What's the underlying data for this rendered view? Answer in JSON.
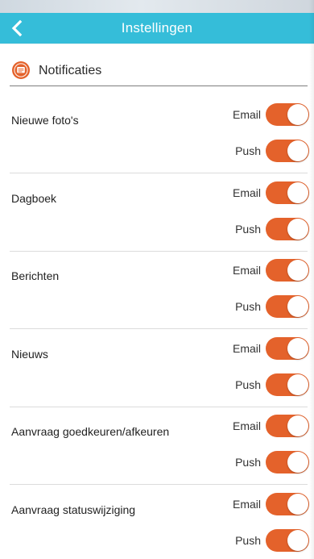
{
  "header": {
    "title": "Instellingen",
    "back_icon": "chevron-left-icon"
  },
  "section": {
    "title": "Notificaties",
    "icon": "message-icon"
  },
  "colors": {
    "header_bg": "#35bdd9",
    "accent": "#e4622b"
  },
  "groups": [
    {
      "label": "Nieuwe foto's",
      "options": [
        {
          "label": "Email",
          "on": true
        },
        {
          "label": "Push",
          "on": true
        }
      ]
    },
    {
      "label": "Dagboek",
      "options": [
        {
          "label": "Email",
          "on": true
        },
        {
          "label": "Push",
          "on": true
        }
      ]
    },
    {
      "label": "Berichten",
      "options": [
        {
          "label": "Email",
          "on": true
        },
        {
          "label": "Push",
          "on": true
        }
      ]
    },
    {
      "label": "Nieuws",
      "options": [
        {
          "label": "Email",
          "on": true
        },
        {
          "label": "Push",
          "on": true
        }
      ]
    },
    {
      "label": "Aanvraag goedkeuren/afkeuren",
      "options": [
        {
          "label": "Email",
          "on": true
        },
        {
          "label": "Push",
          "on": true
        }
      ]
    },
    {
      "label": "Aanvraag statuswijziging",
      "options": [
        {
          "label": "Email",
          "on": true
        },
        {
          "label": "Push",
          "on": true
        }
      ]
    }
  ]
}
